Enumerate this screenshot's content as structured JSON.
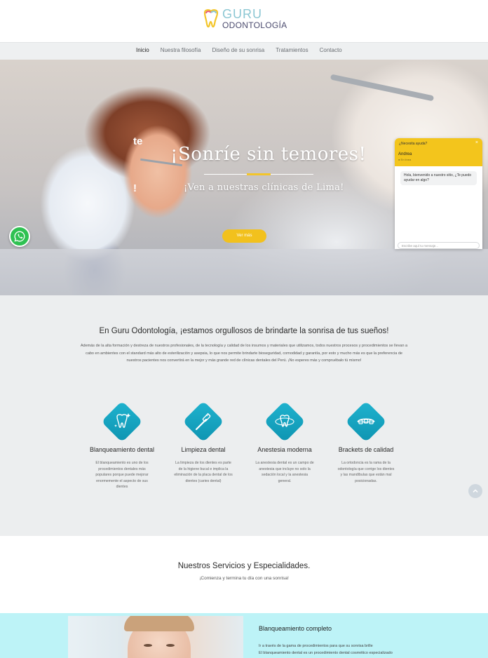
{
  "header": {
    "logo_line1": "GURU",
    "logo_line2": "ODONTOLOGÍA"
  },
  "nav": {
    "items": [
      "Inicio",
      "Nuestra filosofía",
      "Diseño de su sonrisa",
      "Tratamientos",
      "Contacto"
    ],
    "active": "Inicio"
  },
  "hero": {
    "fragment_top": "te",
    "fragment_bottom": "!",
    "title": "¡Sonríe sin temores!",
    "subtitle": "¡Ven a nuestras clínicas de Lima!",
    "button": "Ver más"
  },
  "chat": {
    "header_question": "¿Necesita ayuda?",
    "close": "×",
    "agent_name": "Andrea",
    "agent_status": "● En línea",
    "message": "Hola, bienvenido a nuestro sitio, ¿Te puedo ayudar en algo?",
    "input_placeholder": "Escribe aquí tu mensaje..."
  },
  "intro": {
    "title": "En Guru Odontología, ¡estamos orgullosos de brindarte la sonrisa de tus sueños!",
    "paragraph": "Además de la alta formación y destreza de nuestros profesionales, de la tecnología y calidad de los insumos y materiales que utilizamos, todos nuestros procesos y procedimientos se llevan a cabo en ambientes con el standard más alto de esterilización y asepsia, lo que nos permite brindarte bioseguridad, comodidad y garantía, por esto y mucho más es que la preferencia de nuestros pacientes nos convertirá en la mejor y más grande red de clínicas dentales del Perú. ¡No esperes más y compruébalo tú mismo!",
    "features": [
      {
        "icon": "tooth-sparkle-icon",
        "title": "Blanqueamiento dental",
        "text": "El blanqueamiento es uno de los procedimientos dentales más populares porque puede mejorar enormemente el aspecto de sus dientes"
      },
      {
        "icon": "toothbrush-icon",
        "title": "Limpieza dental",
        "text": "La limpieza de los dientes es parte de la higiene bucal e implica la eliminación de la placa dental de los dientes (caries dental)"
      },
      {
        "icon": "tooth-anesthesia-icon",
        "title": "Anestesia moderna",
        "text": "La anestesia dental es un campo de anestesia que incluye no solo la sedación local y la anestesia general."
      },
      {
        "icon": "braces-icon",
        "title": "Brackets de calidad",
        "text": "La ortodoncia es la rama de la odontología que corrige los dientes y las mandíbulas que están mal posicionadas."
      }
    ]
  },
  "services": {
    "title": "Nuestros Servicios y Especialidades.",
    "subtitle": "¡Comienza y termina tu día con una sonrisa!"
  },
  "whitening": {
    "title": "Blanqueamiento completo",
    "line1": "Ir a través de la gama de procedimientos para que su sonrisa brille",
    "line2": "El blanqueamiento dental es un procedimiento dental cosmético especializado"
  },
  "colors": {
    "accent_yellow": "#f2c11d",
    "teal": "#1fb3cf",
    "whatsapp": "#2fc152",
    "band": "#bdf3f7"
  }
}
